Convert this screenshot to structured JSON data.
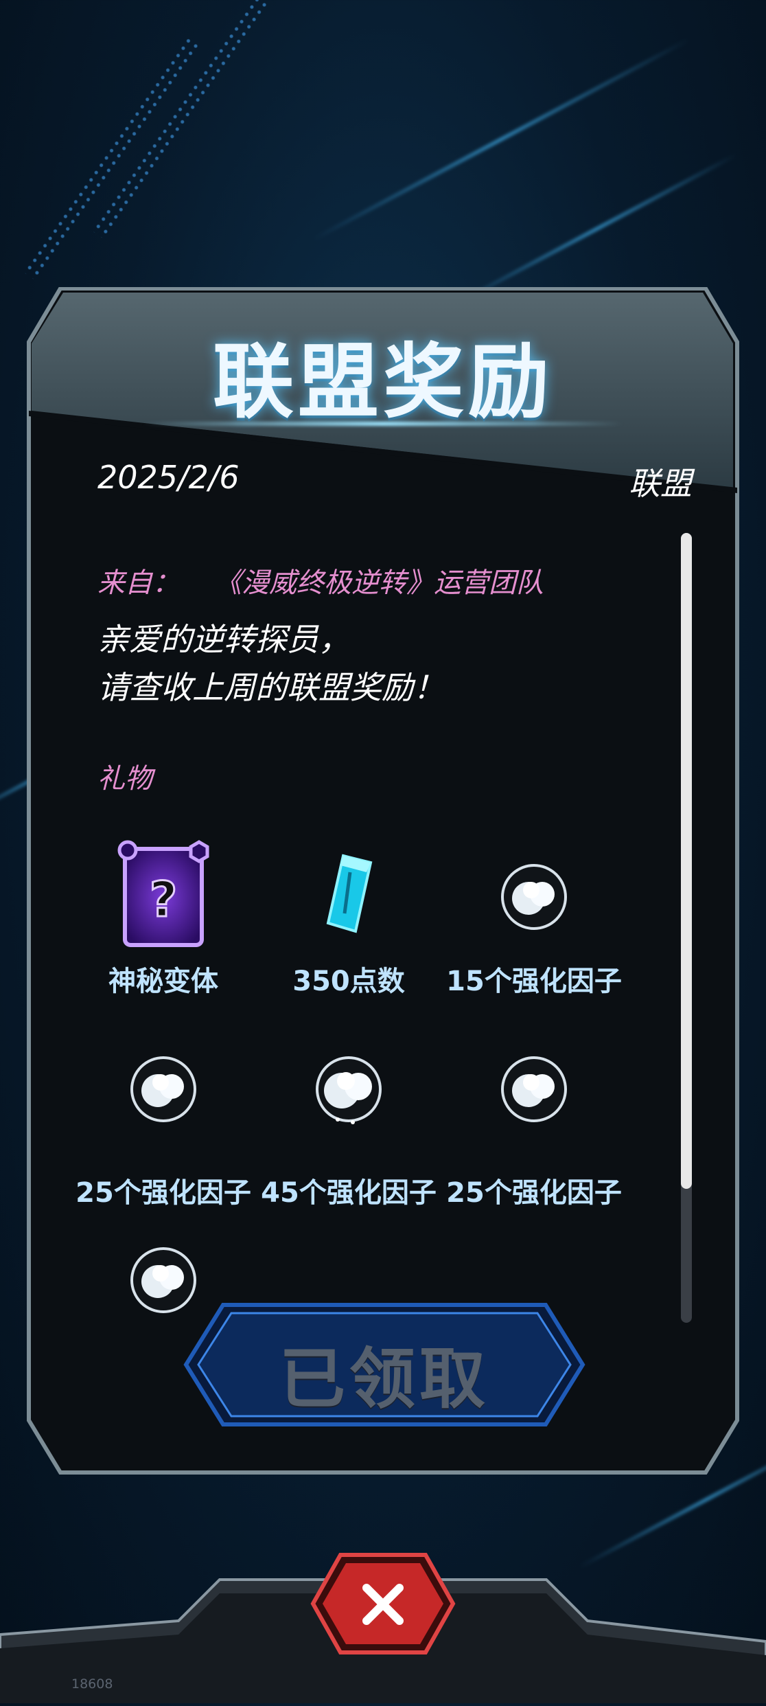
{
  "dialog": {
    "title": "联盟奖励",
    "date": "2025/2/6",
    "category": "联盟",
    "from_label": "来自：",
    "from_sender": "《漫威终极逆转》运营团队",
    "greeting_line1": "亲爱的逆转探员，",
    "greeting_line2": "请查收上周的联盟奖励！",
    "gifts_label": "礼物",
    "rewards": [
      {
        "label": "神秘变体",
        "icon": "mystery-variant-card-icon"
      },
      {
        "label": "350点数",
        "icon": "blue-credits-crystal-icon"
      },
      {
        "label": "15个强化因子",
        "icon": "boost-factor-orb-icon"
      },
      {
        "label": "25个强化因子",
        "icon": "boost-factor-orb-icon"
      },
      {
        "label": "45个强化因子",
        "icon": "boost-factor-orb-icon"
      },
      {
        "label": "25个强化因子",
        "icon": "boost-factor-orb-icon"
      },
      {
        "label": "",
        "icon": "boost-factor-orb-icon"
      }
    ],
    "claim_button_label": "已领取",
    "scroll_progress": 0.83
  },
  "close_button": {
    "icon": "close-x-icon"
  },
  "footer_id": "18608",
  "colors": {
    "accent_pink": "#e58fcf",
    "title_glow": "#5ac8ff",
    "close_red": "#c62828",
    "claimed_gray": "#55606e"
  }
}
